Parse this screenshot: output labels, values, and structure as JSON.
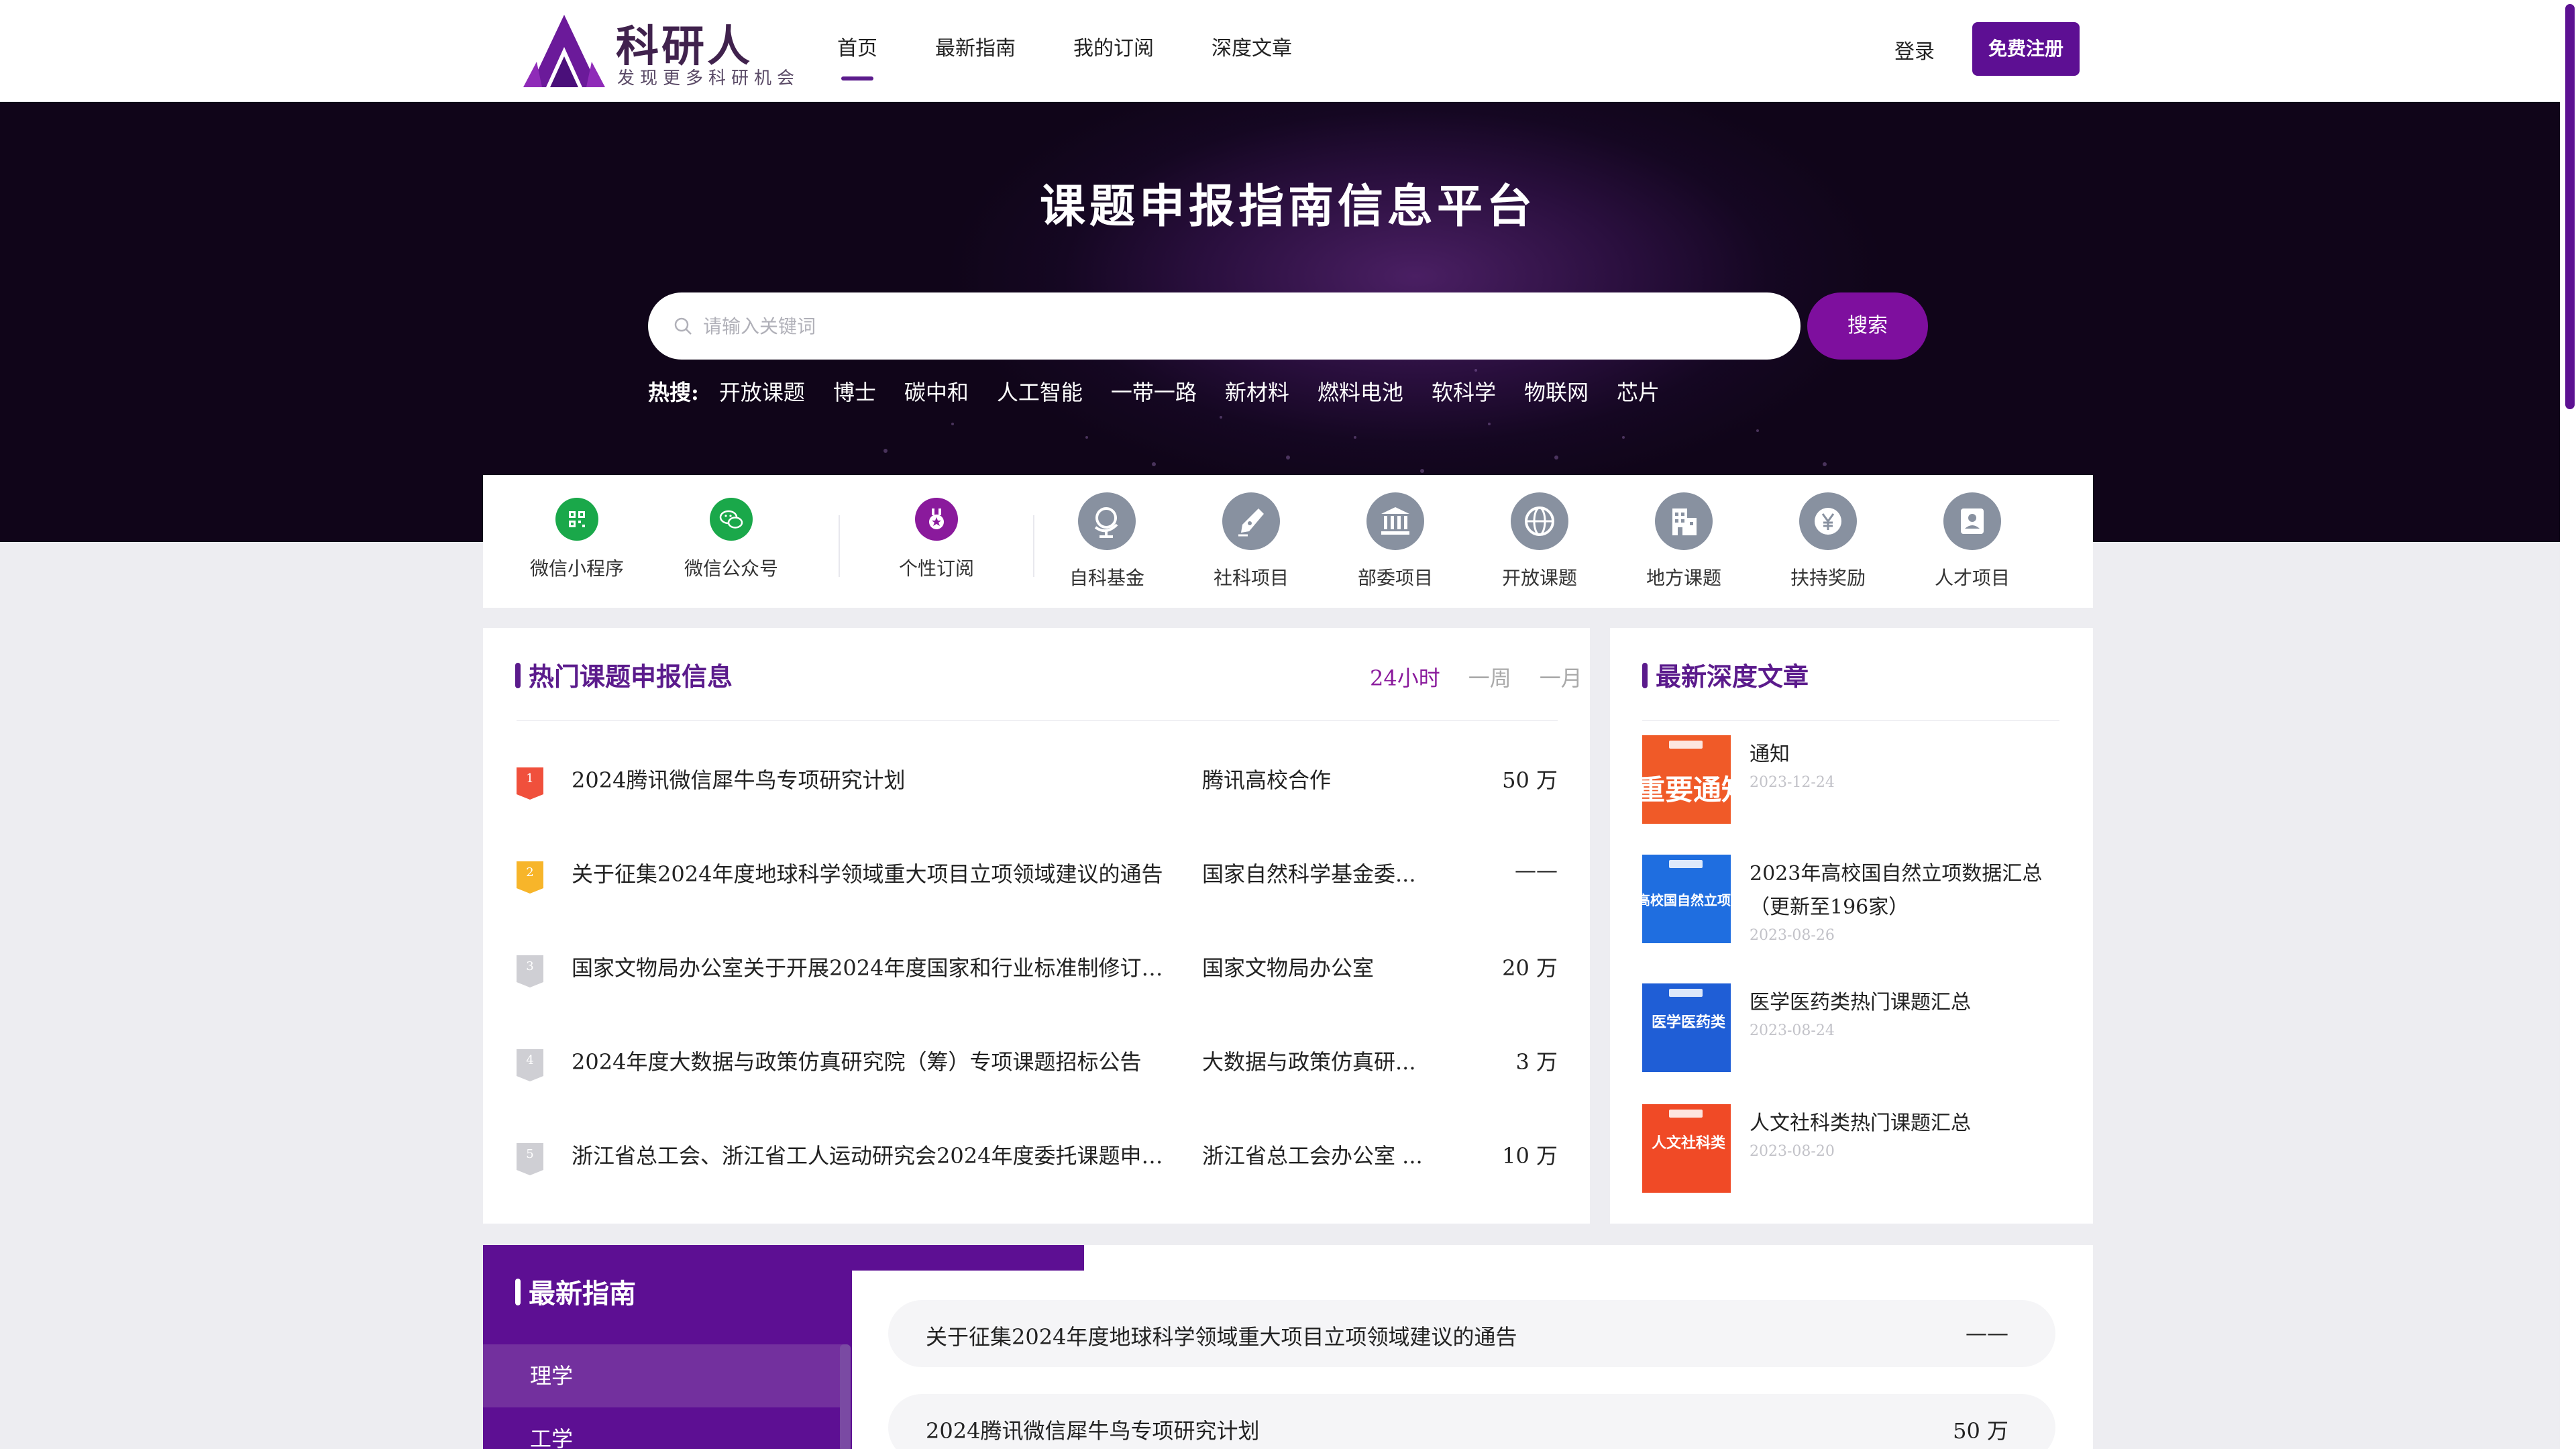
{
  "brand": {
    "name": "科研人",
    "slogan": "发现更多科研机会",
    "accent": "#5d0f93"
  },
  "nav": {
    "items": [
      {
        "label": "首页",
        "active": true
      },
      {
        "label": "最新指南",
        "active": false
      },
      {
        "label": "我的订阅",
        "active": false
      },
      {
        "label": "深度文章",
        "active": false
      }
    ],
    "login": "登录",
    "register": "免费注册"
  },
  "hero": {
    "title": "课题申报指南信息平台",
    "search": {
      "placeholder": "请输入关键词",
      "button": "搜索"
    },
    "hot_label": "热搜:",
    "hot_words": [
      "开放课题",
      "博士",
      "碳中和",
      "人工智能",
      "一带一路",
      "新材料",
      "燃料电池",
      "软科学",
      "物联网",
      "芯片"
    ]
  },
  "quick_links": [
    {
      "label": "微信小程序",
      "icon": "qr-code-icon",
      "color": "#1aa84a"
    },
    {
      "label": "微信公众号",
      "icon": "wechat-icon",
      "color": "#1aa84a"
    },
    {
      "label": "个性订阅",
      "icon": "star-medal-icon",
      "color": "#8a1a9c"
    },
    {
      "label": "自科基金",
      "icon": "globe-stand-icon",
      "color": "#8891a0"
    },
    {
      "label": "社科项目",
      "icon": "pen-nib-icon",
      "color": "#8891a0"
    },
    {
      "label": "部委项目",
      "icon": "government-building-icon",
      "color": "#8891a0"
    },
    {
      "label": "开放课题",
      "icon": "globe-icon",
      "color": "#8891a0"
    },
    {
      "label": "地方课题",
      "icon": "office-building-icon",
      "color": "#8891a0"
    },
    {
      "label": "扶持奖励",
      "icon": "yen-coin-icon",
      "color": "#8891a0"
    },
    {
      "label": "人才项目",
      "icon": "person-badge-icon",
      "color": "#8891a0"
    }
  ],
  "hot": {
    "title": "热门课题申报信息",
    "tabs": [
      "24小时",
      "一周",
      "一月"
    ],
    "active_tab": "24小时",
    "rows": [
      {
        "rank": "1",
        "title": "2024腾讯微信犀牛鸟专项研究计划",
        "org": "腾讯高校合作",
        "amount": "50 万",
        "badge_color": "#f0503c"
      },
      {
        "rank": "2",
        "title": "关于征集2024年度地球科学领域重大项目立项领域建议的通告",
        "org": "国家自然科学基金委...",
        "amount": "——",
        "badge_color": "#f7b52a"
      },
      {
        "rank": "3",
        "title": "国家文物局办公室关于开展2024年度国家和行业标准制修订计...",
        "org": "国家文物局办公室",
        "amount": "20 万",
        "badge_color": "#cfcfd4"
      },
      {
        "rank": "4",
        "title": "2024年度大数据与政策仿真研究院（筹）专项课题招标公告",
        "org": "大数据与政策仿真研...",
        "amount": "3 万",
        "badge_color": "#cfcfd4"
      },
      {
        "rank": "5",
        "title": "浙江省总工会、浙江省工人运动研究会2024年度委托课题申报...",
        "org": "浙江省总工会办公室 ...",
        "amount": "10 万",
        "badge_color": "#cfcfd4"
      }
    ]
  },
  "articles": {
    "title": "最新深度文章",
    "items": [
      {
        "title": "通知",
        "date": "2023-12-24",
        "thumb_text": "重要通知",
        "thumb_color": "#f05a28"
      },
      {
        "title": "2023年高校国自然立项数据汇总（更新至196家）",
        "date": "2023-08-26",
        "thumb_text": "高校国自然立项数",
        "thumb_color": "#1f6ee0"
      },
      {
        "title": "医学医药类热门课题汇总",
        "date": "2023-08-24",
        "thumb_text": "医学医药类",
        "thumb_color": "#1f5ed6"
      },
      {
        "title": "人文社科类热门课题汇总",
        "date": "2023-08-20",
        "thumb_text": "人文社科类",
        "thumb_color": "#f04a26"
      }
    ]
  },
  "guide": {
    "title": "最新指南",
    "categories": [
      "理学",
      "工学"
    ],
    "active_category": "理学",
    "rows": [
      {
        "title": "关于征集2024年度地球科学领域重大项目立项领域建议的通告",
        "amount": "——"
      },
      {
        "title": "2024腾讯微信犀牛鸟专项研究计划",
        "amount": "50 万"
      }
    ]
  }
}
